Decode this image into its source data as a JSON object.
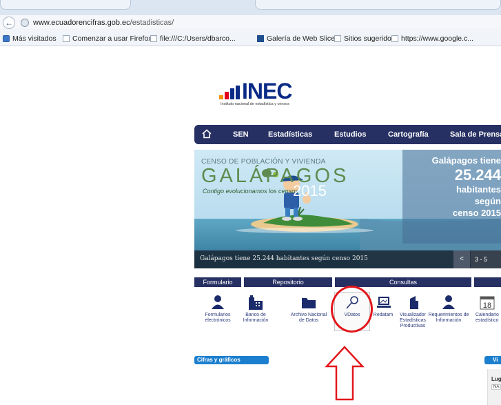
{
  "browser": {
    "url_domain": "www.ecuadorencifras.gob.ec",
    "url_path": "/estadisticas/",
    "bookmarks": [
      "Más visitados",
      "Comenzar a usar Firefox",
      "file:///C:/Users/dbarco...",
      "Galería de Web Slice",
      "Sitios sugeridos",
      "https://www.google.c..."
    ]
  },
  "logo": {
    "name": "INEC",
    "subtitle": "Instituto nacional de estadística y censos"
  },
  "nav": {
    "items": [
      "SEN",
      "Estadísticas",
      "Estudios",
      "Cartografía",
      "Sala de Prensa"
    ]
  },
  "banner": {
    "line1": "CENSO DE POBLACIÓN Y VIVIENDA",
    "line2": "GALÁPAGOS",
    "line3": "Contigo evolucionamos los censos",
    "year": "2015",
    "headline": "Galápagos tiene",
    "number": "25.244",
    "l1": "habitantes",
    "l2": "según",
    "l3": "censo 2015",
    "caption": "Galápagos tiene 25.244 habitantes según censo 2015",
    "prev": "<",
    "pager": "3 - 5"
  },
  "categories": [
    "Formulario",
    "Repositorio",
    "Consultas"
  ],
  "tiles": [
    {
      "label": "Formularios electrónicos",
      "icon": "person-icon"
    },
    {
      "label": "Banco de Información",
      "icon": "building-icon"
    },
    {
      "label": "Archivo Nacional de Datos",
      "icon": "folder-icon"
    },
    {
      "label": "VDatos",
      "icon": "magnifier-icon"
    },
    {
      "label": "Redatam",
      "icon": "monitor-icon"
    },
    {
      "label": "Visualizador Estadísticas Productivas",
      "icon": "tower-icon"
    },
    {
      "label": "Requerimientos de Información",
      "icon": "person-icon"
    },
    {
      "label": "Calendario estadístico",
      "icon": "calendar-icon",
      "day": "18"
    }
  ],
  "sections": {
    "cifras": "Cifras y gráficos",
    "vi": "Vi",
    "side_label": "Lug",
    "side_value": "NA"
  },
  "colors": {
    "nav_bg": "#273063",
    "brand_blue": "#0a2a86",
    "accent_blue": "#1c7fce",
    "highlight_red": "#e2161b"
  }
}
